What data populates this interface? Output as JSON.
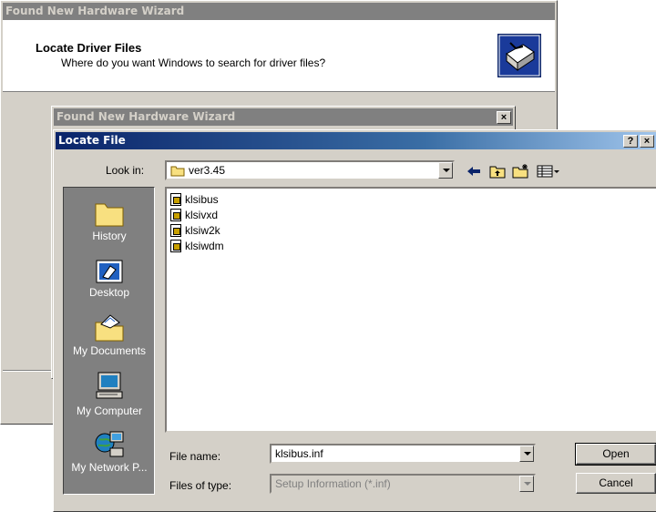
{
  "bg_wizard": {
    "title": "Found New Hardware Wizard",
    "heading": "Locate Driver Files",
    "subheading": "Where do you want Windows to search for driver files?"
  },
  "mid_wizard": {
    "title": "Found New Hardware Wizard",
    "close_label": "×"
  },
  "locate": {
    "title": "Locate File",
    "help_label": "?",
    "close_label": "×",
    "look_in_label": "Look in:",
    "look_in_value": "ver3.45",
    "places": [
      {
        "label": "History",
        "icon": "history-folder-icon"
      },
      {
        "label": "Desktop",
        "icon": "desktop-icon"
      },
      {
        "label": "My Documents",
        "icon": "my-documents-icon"
      },
      {
        "label": "My Computer",
        "icon": "my-computer-icon"
      },
      {
        "label": "My Network P...",
        "icon": "network-places-icon"
      }
    ],
    "files": [
      "klsibus",
      "klsivxd",
      "klsiw2k",
      "klsiwdm"
    ],
    "file_name_label": "File name:",
    "file_name_value": "klsibus.inf",
    "files_of_type_label": "Files of type:",
    "files_of_type_value": "Setup Information (*.inf)",
    "open_label": "Open",
    "cancel_label": "Cancel"
  }
}
